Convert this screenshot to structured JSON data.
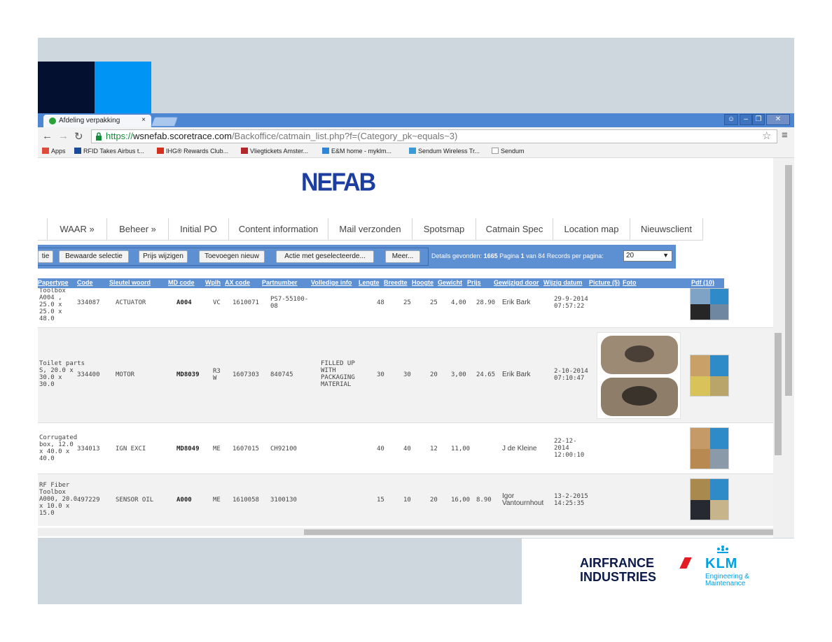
{
  "browser": {
    "tab_title": "Afdeling verpakking",
    "tab_close": "×",
    "url": {
      "https": "https://",
      "host": "wsnefab.scoretrace.com",
      "path": "/Backoffice/catmain_list.php?f=(Category_pk~equals~3)"
    },
    "bookmarks": [
      {
        "label": "Apps",
        "color": "#e04a3c"
      },
      {
        "label": "RFID Takes Airbus t...",
        "color": "#1a4a9a"
      },
      {
        "label": "IHG® Rewards Club...",
        "color": "#d2301c"
      },
      {
        "label": "Vliegtickets Amster...",
        "color": "#b3262a"
      },
      {
        "label": "E&M home - myklm...",
        "color": "#2f86d6"
      },
      {
        "label": "Sendum Wireless Tr...",
        "color": "#3b9ad8"
      },
      {
        "label": "Sendum",
        "color": "#999999"
      }
    ]
  },
  "page": {
    "logo": "NEFAB",
    "nav": [
      "WAAR »",
      "Beheer »",
      "Initial PO",
      "Content information",
      "Mail verzonden",
      "Spotsmap",
      "Catmain Spec",
      "Location map",
      "Nieuwsclient"
    ],
    "actions": {
      "partial_btn": "tie",
      "saved_selection": "Bewaarde selectie",
      "change_prices": "Prijs wijzigen",
      "add_new": "Toevoegen nieuw",
      "action_selected": "Actie met geselecteerde...",
      "more": "Meer...",
      "info_prefix": "Details gevonden:",
      "found": "1665",
      "page_label": "Pagina",
      "page": "1",
      "of_label": "van",
      "pages": "84",
      "rpp_label": "Records per pagina:",
      "rpp_value": "20"
    },
    "columns": [
      "Papertype",
      "Code",
      "Sleutel woord",
      "MD code",
      "Wplh",
      "AX code",
      "Partnumber",
      "Volledige info",
      "Lengte",
      "Breedte",
      "Hoogte",
      "Gewicht",
      "Prijs",
      "Gewijzigd door",
      "Wijzig datum",
      "Picture (5)",
      "Foto",
      "Pdf (10)"
    ],
    "rows": [
      {
        "papertype": "Toolbox\nA004 ,\n25.0 x\n25.0 x\n48.0",
        "code": "334087",
        "keyword": "ACTUATOR",
        "md": "A004",
        "wplh": "VC",
        "ax": "1610071",
        "part": "PS7-55100-\n08",
        "info": "",
        "l": "48",
        "b": "25",
        "h": "25",
        "g": "4,00",
        "p": "28.90",
        "by": "Erik Bark",
        "date": "29-9-2014\n07:57:22"
      },
      {
        "papertype": "Toilet parts\nS, 20.0 x\n30.0 x\n30.0",
        "code": "334400",
        "keyword": "MOTOR",
        "md": "MD8039",
        "wplh": "R3\nW",
        "ax": "1607303",
        "part": "840745",
        "info": "FILLED UP\nWITH\nPACKAGING\nMATERIAL",
        "l": "30",
        "b": "30",
        "h": "20",
        "g": "3,00",
        "p": "24.65",
        "by": "Erik Bark",
        "date": "2-10-2014\n07:10:47"
      },
      {
        "papertype": "Corrugated\nbox, 12.0\nx 40.0 x\n40.0",
        "code": "334013",
        "keyword": "IGN EXCI",
        "md": "MD8049",
        "wplh": "ME",
        "ax": "1607015",
        "part": "CH92100",
        "info": "",
        "l": "40",
        "b": "40",
        "h": "12",
        "g": "11,00",
        "p": "",
        "by": "J de Kleine",
        "date": "22-12-\n2014\n12:00:10"
      },
      {
        "papertype": "RF Fiber\nToolbox\nA000, 20.0\nx 10.0 x\n15.0",
        "code": "497229",
        "keyword": "SENSOR OIL",
        "md": "A000",
        "wplh": "ME",
        "ax": "1610058",
        "part": "3100130",
        "info": "",
        "l": "15",
        "b": "10",
        "h": "20",
        "g": "16,00",
        "p": "8.90",
        "by": "Igor\nVantournhout",
        "date": "13-2-2015\n14:25:35"
      }
    ]
  },
  "footer": {
    "airfrance_line1": "AIRFRANCE",
    "airfrance_line2": "INDUSTRIES",
    "klm": "KLM",
    "klm_sub": "Engineering &\nMaintenance"
  },
  "colors": {
    "tabstrip": "#4d86d2",
    "actionbar": "#5d8fd3",
    "nefab": "#1b3ea0",
    "klm": "#00a1e4",
    "airfrance_red": "#e31b23"
  }
}
